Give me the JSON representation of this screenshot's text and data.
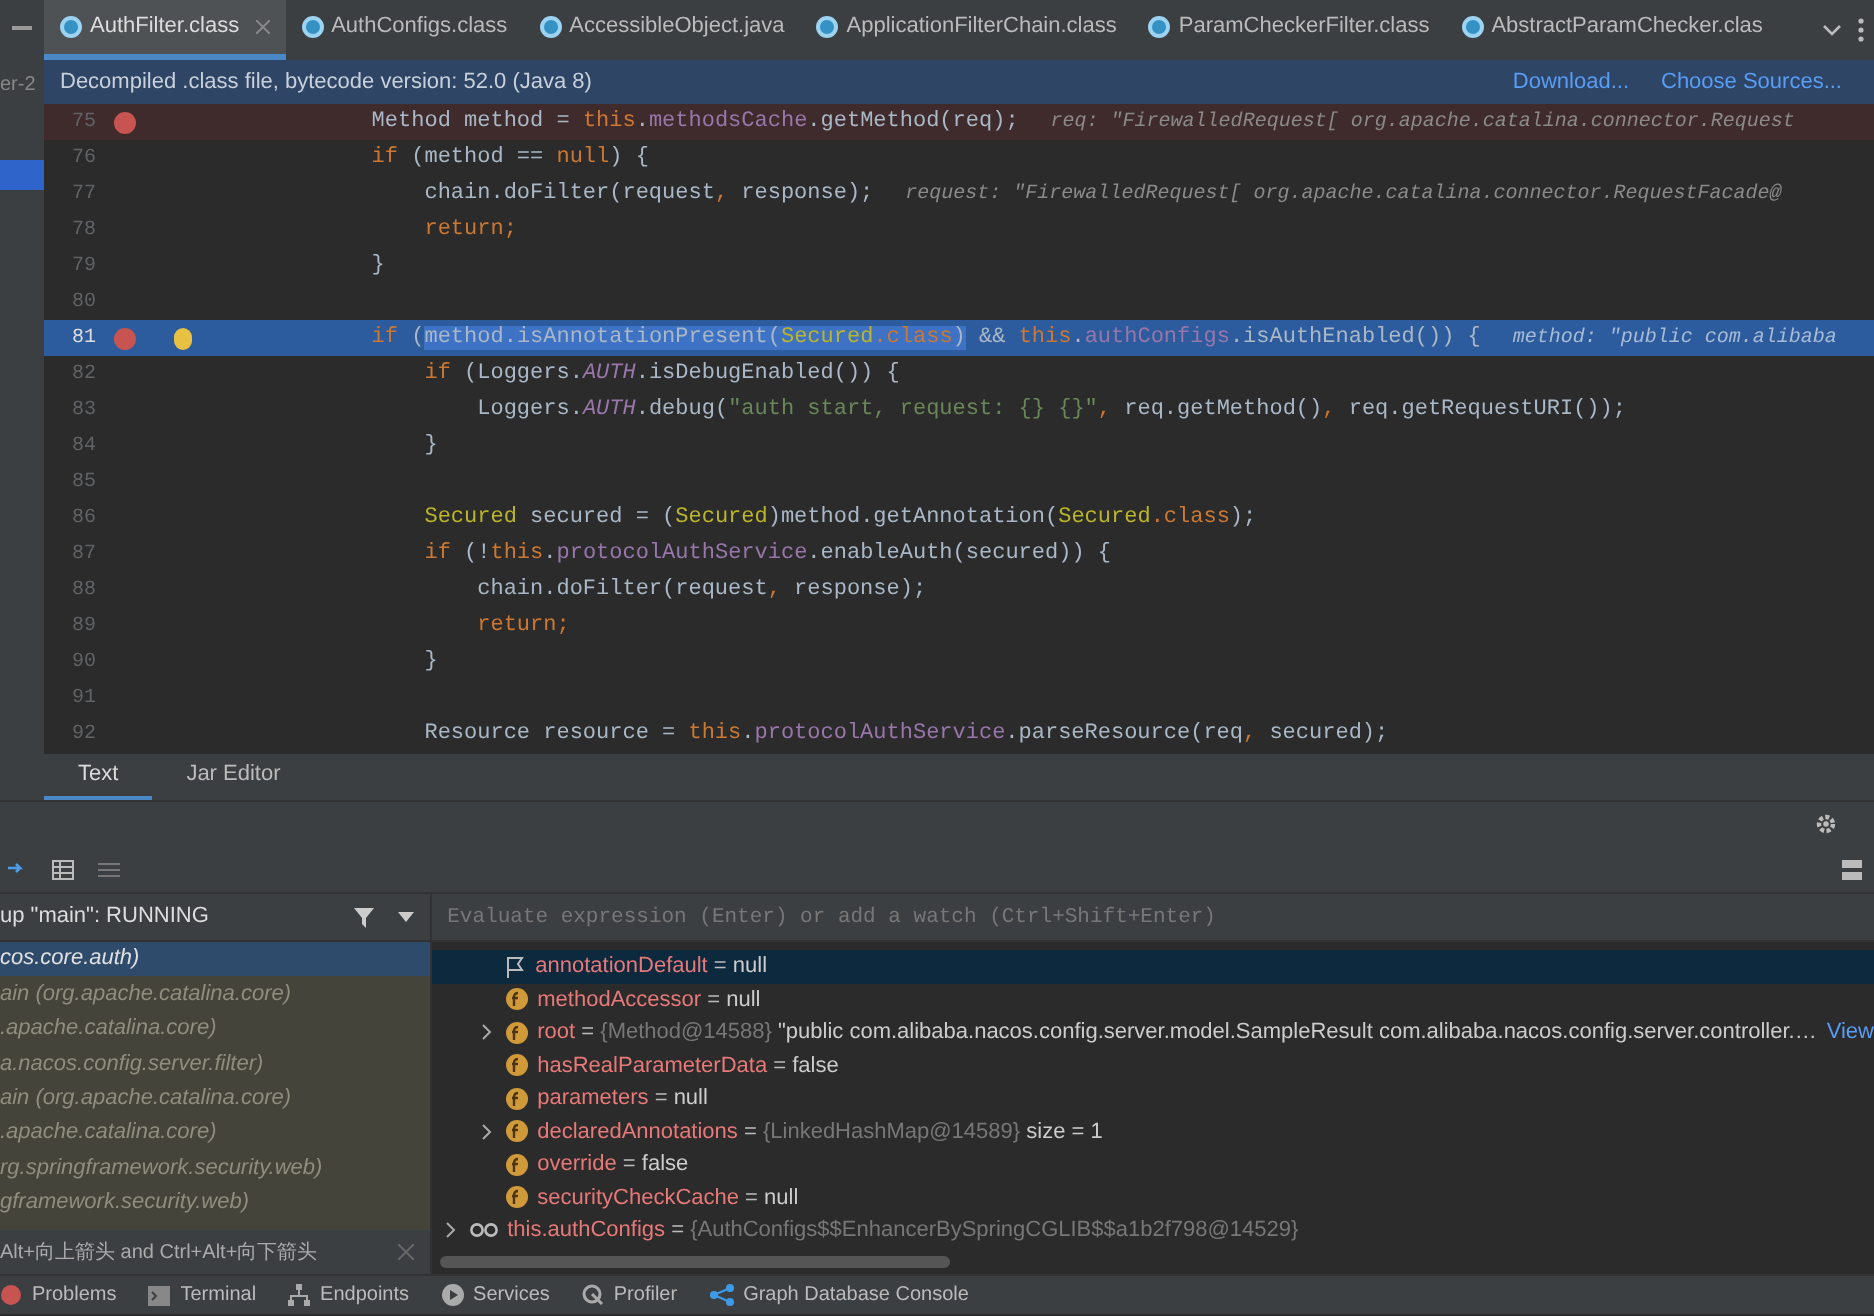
{
  "sidebar": {
    "label": "er-2"
  },
  "tabs": [
    {
      "label": "AuthFilter.class",
      "selected": true
    },
    {
      "label": "AuthConfigs.class",
      "selected": false
    },
    {
      "label": "AccessibleObject.java",
      "selected": false
    },
    {
      "label": "ApplicationFilterChain.class",
      "selected": false
    },
    {
      "label": "ParamCheckerFilter.class",
      "selected": false
    },
    {
      "label": "AbstractParamChecker.clas",
      "selected": false
    }
  ],
  "info_bar": {
    "text": "Decompiled .class file, bytecode version: 52.0 (Java 8)",
    "links": [
      "Download...",
      "Choose Sources..."
    ]
  },
  "code_lines": [
    {
      "number": "75",
      "breakpoint": true,
      "current": false,
      "tokens": [
        {
          "kind": "plain",
          "text": "        Method method = "
        },
        {
          "kind": "keyword",
          "text": "this"
        },
        {
          "kind": "plain",
          "text": "."
        },
        {
          "kind": "field",
          "text": "methodsCache"
        },
        {
          "kind": "plain",
          "text": ".getMethod(req);"
        }
      ],
      "hint": "req: \"FirewalledRequest[ org.apache.catalina.connector.Request"
    },
    {
      "number": "76",
      "breakpoint": false,
      "current": false,
      "tokens": [
        {
          "kind": "keyword",
          "text": "        if"
        },
        {
          "kind": "plain",
          "text": " (method == "
        },
        {
          "kind": "keyword",
          "text": "null"
        },
        {
          "kind": "plain",
          "text": ") {"
        }
      ]
    },
    {
      "number": "77",
      "breakpoint": false,
      "current": false,
      "tokens": [
        {
          "kind": "plain",
          "text": "            chain.doFilter(request"
        },
        {
          "kind": "keyword",
          "text": ","
        },
        {
          "kind": "plain",
          "text": " response);"
        }
      ],
      "hint": "request: \"FirewalledRequest[ org.apache.catalina.connector.RequestFacade@"
    },
    {
      "number": "78",
      "breakpoint": false,
      "current": false,
      "tokens": [
        {
          "kind": "keyword",
          "text": "            return;"
        }
      ]
    },
    {
      "number": "79",
      "breakpoint": false,
      "current": false,
      "tokens": [
        {
          "kind": "plain",
          "text": "        }"
        }
      ]
    },
    {
      "number": "80",
      "breakpoint": false,
      "current": false
    },
    {
      "number": "81",
      "breakpoint": true,
      "current": true,
      "tokens": [
        {
          "kind": "keyword",
          "text": "        if "
        },
        {
          "kind": "plain",
          "text": "("
        },
        {
          "kind": "plain",
          "text": "method.isAnnotationPresent(",
          "selected": true
        },
        {
          "kind": "type",
          "text": "Secured",
          "selected": true
        },
        {
          "kind": "keyword",
          "text": ".class",
          "selected": true
        },
        {
          "kind": "plain",
          "text": ")",
          "selected": true
        },
        {
          "kind": "plain",
          "text": " && "
        },
        {
          "kind": "keyword",
          "text": "this"
        },
        {
          "kind": "plain",
          "text": "."
        },
        {
          "kind": "field",
          "text": "authConfigs"
        },
        {
          "kind": "plain",
          "text": ".isAuthEnabled()) {"
        }
      ],
      "hint": "method: \"public com.alibaba"
    },
    {
      "number": "82",
      "breakpoint": false,
      "current": false,
      "tokens": [
        {
          "kind": "keyword",
          "text": "            if"
        },
        {
          "kind": "plain",
          "text": " (Loggers."
        },
        {
          "kind": "static",
          "text": "AUTH"
        },
        {
          "kind": "plain",
          "text": ".isDebugEnabled()) {"
        }
      ]
    },
    {
      "number": "83",
      "breakpoint": false,
      "current": false,
      "tokens": [
        {
          "kind": "plain",
          "text": "                Loggers."
        },
        {
          "kind": "static",
          "text": "AUTH"
        },
        {
          "kind": "plain",
          "text": ".debug("
        },
        {
          "kind": "string",
          "text": "\"auth start, request: {} {}\""
        },
        {
          "kind": "keyword",
          "text": ","
        },
        {
          "kind": "plain",
          "text": " req.getMethod()"
        },
        {
          "kind": "keyword",
          "text": ","
        },
        {
          "kind": "plain",
          "text": " req.getRequestURI());"
        }
      ]
    },
    {
      "number": "84",
      "breakpoint": false,
      "current": false,
      "tokens": [
        {
          "kind": "plain",
          "text": "            }"
        }
      ]
    },
    {
      "number": "85",
      "breakpoint": false,
      "current": false
    },
    {
      "number": "86",
      "breakpoint": false,
      "current": false,
      "tokens": [
        {
          "kind": "type",
          "text": "            Secured"
        },
        {
          "kind": "plain",
          "text": " secured = ("
        },
        {
          "kind": "type",
          "text": "Secured"
        },
        {
          "kind": "plain",
          "text": ")method.getAnnotation("
        },
        {
          "kind": "type",
          "text": "Secured"
        },
        {
          "kind": "keyword",
          "text": ".class"
        },
        {
          "kind": "plain",
          "text": ");"
        }
      ]
    },
    {
      "number": "87",
      "breakpoint": false,
      "current": false,
      "tokens": [
        {
          "kind": "keyword",
          "text": "            if"
        },
        {
          "kind": "plain",
          "text": " (!"
        },
        {
          "kind": "keyword",
          "text": "this"
        },
        {
          "kind": "plain",
          "text": "."
        },
        {
          "kind": "field",
          "text": "protocolAuthService"
        },
        {
          "kind": "plain",
          "text": ".enableAuth(secured)) {"
        }
      ]
    },
    {
      "number": "88",
      "breakpoint": false,
      "current": false,
      "tokens": [
        {
          "kind": "plain",
          "text": "                chain.doFilter(request"
        },
        {
          "kind": "keyword",
          "text": ","
        },
        {
          "kind": "plain",
          "text": " response);"
        }
      ]
    },
    {
      "number": "89",
      "breakpoint": false,
      "current": false,
      "tokens": [
        {
          "kind": "keyword",
          "text": "                return;"
        }
      ]
    },
    {
      "number": "90",
      "breakpoint": false,
      "current": false,
      "tokens": [
        {
          "kind": "plain",
          "text": "            }"
        }
      ]
    },
    {
      "number": "91",
      "breakpoint": false,
      "current": false
    },
    {
      "number": "92",
      "breakpoint": false,
      "current": false,
      "tokens": [
        {
          "kind": "plain",
          "text": "            Resource resource = "
        },
        {
          "kind": "keyword",
          "text": "this"
        },
        {
          "kind": "plain",
          "text": "."
        },
        {
          "kind": "field",
          "text": "protocolAuthService"
        },
        {
          "kind": "plain",
          "text": ".parseResource(req"
        },
        {
          "kind": "keyword",
          "text": ","
        },
        {
          "kind": "plain",
          "text": " secured);"
        }
      ]
    }
  ],
  "editor_tabs": [
    {
      "label": "Text",
      "selected": true
    },
    {
      "label": "Jar Editor",
      "selected": false
    }
  ],
  "debugger": {
    "thread": "up \"main\": RUNNING",
    "frames": [
      {
        "text": "cos.core.auth)",
        "selected": true
      },
      {
        "text": "ain (org.apache.catalina.core)",
        "selected": false
      },
      {
        "text": ".apache.catalina.core)",
        "selected": false
      },
      {
        "text": "a.nacos.config.server.filter)",
        "selected": false
      },
      {
        "text": "ain (org.apache.catalina.core)",
        "selected": false
      },
      {
        "text": ".apache.catalina.core)",
        "selected": false
      },
      {
        "text": "rg.springframework.security.web)",
        "selected": false
      },
      {
        "text": "gframework.security.web)",
        "selected": false
      }
    ],
    "tooltip": "Alt+向上箭头 and Ctrl+Alt+向下箭头",
    "evaluate_placeholder": "Evaluate expression (Enter) or add a watch (Ctrl+Shift+Enter)",
    "variables": [
      {
        "kind": "flag",
        "expandable": false,
        "selected": true,
        "name": "annotationDefault",
        "equals": "=",
        "value": "null"
      },
      {
        "kind": "field",
        "expandable": false,
        "selected": false,
        "name": "methodAccessor",
        "equals": "=",
        "value": "null"
      },
      {
        "kind": "field",
        "expandable": true,
        "selected": false,
        "name": "root",
        "equals": "=",
        "ref": "{Method@14588}",
        "value": "\"public com.alibaba.nacos.config.server.model.SampleResult com.alibaba.nacos.config.server.controller.…",
        "link": "View"
      },
      {
        "kind": "field",
        "expandable": false,
        "selected": false,
        "name": "hasRealParameterData",
        "equals": "=",
        "value": "false"
      },
      {
        "kind": "field",
        "expandable": false,
        "selected": false,
        "name": "parameters",
        "equals": "=",
        "value": "null"
      },
      {
        "kind": "field",
        "expandable": true,
        "selected": false,
        "name": "declaredAnnotations",
        "equals": "=",
        "ref": "{LinkedHashMap@14589}",
        "value": "size = 1"
      },
      {
        "kind": "field",
        "expandable": false,
        "selected": false,
        "name": "override",
        "equals": "=",
        "value": "false"
      },
      {
        "kind": "field",
        "expandable": false,
        "selected": false,
        "name": "securityCheckCache",
        "equals": "=",
        "value": "null"
      },
      {
        "kind": "watch",
        "expandable": true,
        "selected": false,
        "name": "this.authConfigs",
        "equals": "=",
        "ref": "{AuthConfigs$$EnhancerBySpringCGLIB$$a1b2f798@14529}"
      }
    ]
  },
  "tool_windows": [
    {
      "kind": "problems",
      "label": "Problems"
    },
    {
      "kind": "terminal",
      "label": "Terminal"
    },
    {
      "kind": "endpoints",
      "label": "Endpoints"
    },
    {
      "kind": "services",
      "label": "Services"
    },
    {
      "kind": "profiler",
      "label": "Profiler"
    },
    {
      "kind": "graph",
      "label": "Graph Database Console"
    }
  ]
}
